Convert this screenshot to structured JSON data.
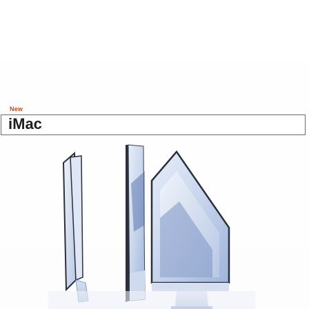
{
  "card": {
    "eyebrow": "New",
    "title": "iMac"
  },
  "product_image": {
    "icon": "imac-product-image",
    "colors": {
      "frame": "#2b2f3a",
      "screen_light": "#d9e3f3",
      "screen_mid": "#b9c9e4",
      "screen_dark": "#6f86b8",
      "base": "#c9d4e8"
    }
  }
}
